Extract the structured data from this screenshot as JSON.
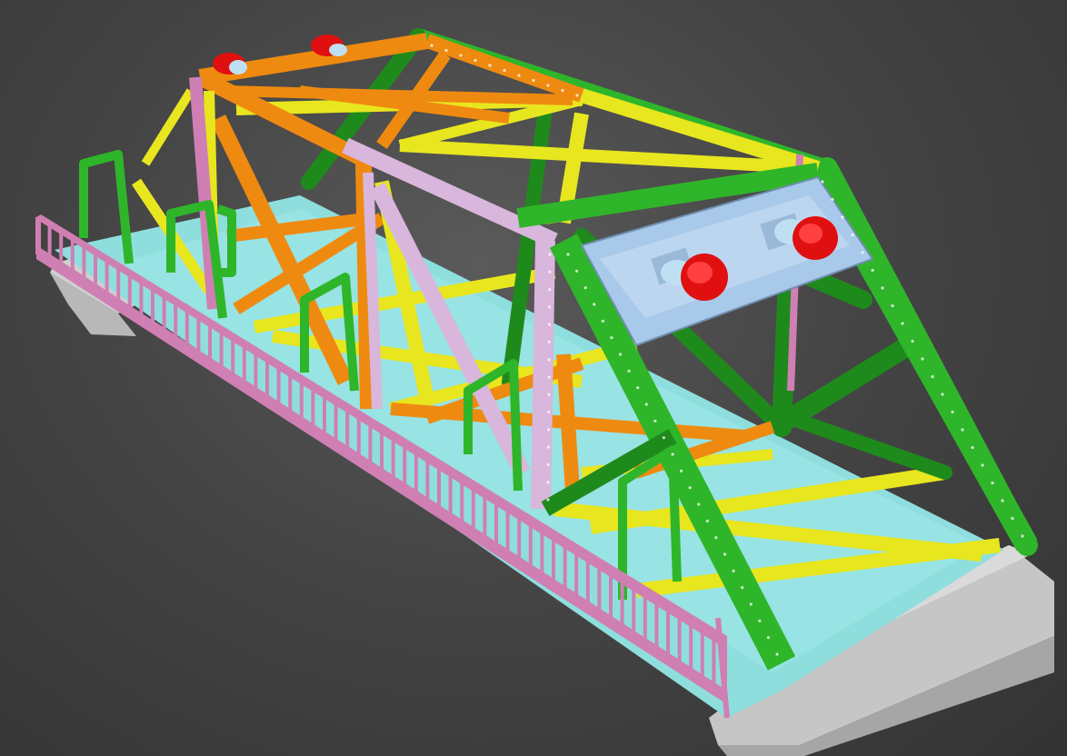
{
  "viewport": {
    "background": "#4a4a4a",
    "subject": "truss-bridge-3d-model"
  },
  "colors": {
    "green": "#2fb52a",
    "green_dark": "#1f8a1c",
    "yellow": "#e8e61e",
    "yellow_dark": "#b8b511",
    "orange": "#ef8a10",
    "orange_dark": "#c46c08",
    "lavender": "#d9b6dc",
    "pink": "#cf7fb3",
    "light_blue": "#a9c9ea",
    "red": "#e01010",
    "cyan": "#8ee2e2",
    "concrete": "#c9c9c9",
    "concrete_dark": "#9a9a9a"
  }
}
